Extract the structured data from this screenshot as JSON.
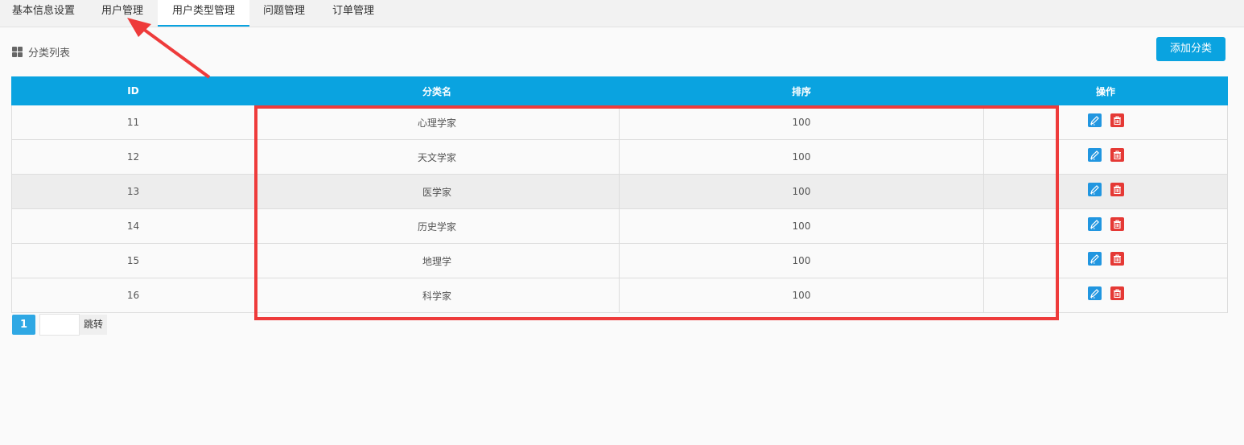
{
  "tabs": [
    {
      "label": "基本信息设置"
    },
    {
      "label": "用户管理"
    },
    {
      "label": "用户类型管理"
    },
    {
      "label": "问题管理"
    },
    {
      "label": "订单管理"
    }
  ],
  "active_tab": "用户类型管理",
  "section": {
    "title": "分类列表",
    "icon": "grid-icon"
  },
  "add_button": {
    "label": "添加分类"
  },
  "table": {
    "headers": [
      "ID",
      "分类名",
      "排序",
      "操作"
    ],
    "rows": [
      {
        "id": "11",
        "name": "心理学家",
        "order": "100"
      },
      {
        "id": "12",
        "name": "天文学家",
        "order": "100"
      },
      {
        "id": "13",
        "name": "医学家",
        "order": "100"
      },
      {
        "id": "14",
        "name": "历史学家",
        "order": "100"
      },
      {
        "id": "15",
        "name": "地理学",
        "order": "100"
      },
      {
        "id": "16",
        "name": "科学家",
        "order": "100"
      }
    ],
    "highlighted_row": "13",
    "row_actions": {
      "edit_icon": "edit-icon",
      "delete_icon": "trash-icon"
    }
  },
  "pagination": {
    "current_page": "1",
    "input_value": "",
    "jump_label": "跳转"
  },
  "colors": {
    "accent": "#0aa3e0",
    "edit": "#2196e0",
    "delete": "#e53935",
    "annotation": "#ee3b3b"
  }
}
